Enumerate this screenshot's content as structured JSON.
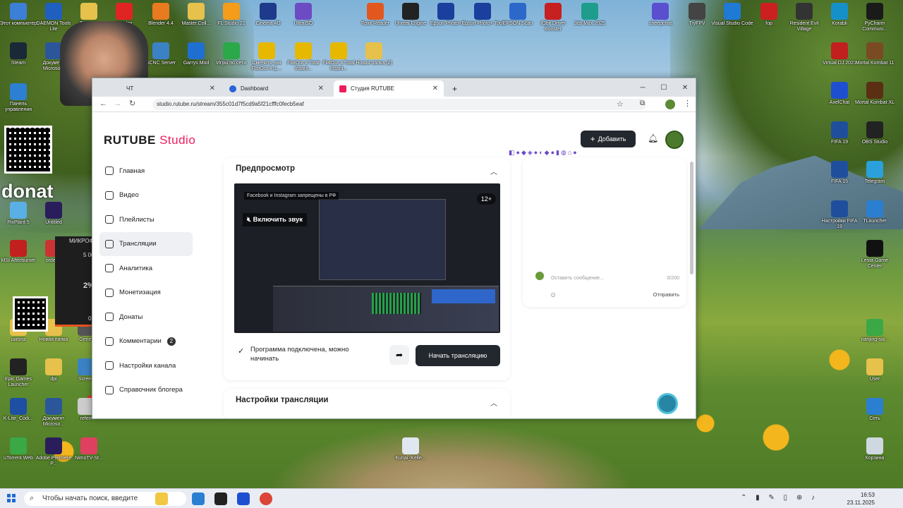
{
  "desktop": {
    "icons_left": [
      {
        "label": "Этот компьютер",
        "color": "#3c7fd6"
      },
      {
        "label": "DAEMON Tools Lite",
        "color": "#1f5fbf"
      },
      {
        "label": "Лазарев",
        "color": "#e6c14c"
      },
      {
        "label": "Yandex",
        "color": "#e02424"
      },
      {
        "label": "Blender 4.4",
        "color": "#e87a20"
      },
      {
        "label": "Master.Coll...",
        "color": "#e6c14c"
      },
      {
        "label": "FL Studio 21",
        "color": "#f59c1a"
      },
      {
        "label": "Cinema 4D",
        "color": "#1e3a8a"
      },
      {
        "label": "UltraISO",
        "color": "#6d4bc3"
      }
    ],
    "icons_right": [
      {
        "label": "Foxit Reader",
        "color": "#e2571e"
      },
      {
        "label": "Unreal Engine",
        "color": "#222222"
      },
      {
        "label": "Epson Photo+",
        "color": "#1a3f9c"
      },
      {
        "label": "Epson Photo+ Tool",
        "color": "#1a3f9c"
      },
      {
        "label": "EPSON Scan",
        "color": "#2b68c9"
      },
      {
        "label": "IObit Driver Booster",
        "color": "#c62020"
      },
      {
        "label": "3ds Max 2025",
        "color": "#1e9c8c"
      },
      {
        "label": "sheepchat",
        "color": "#5a4fcf"
      },
      {
        "label": "TryFPV",
        "color": "#444444"
      },
      {
        "label": "Visual Studio Code",
        "color": "#1f7ad6"
      },
      {
        "label": "fop",
        "color": "#cc1f1f"
      },
      {
        "label": "Resident Evil Village",
        "color": "#333333"
      },
      {
        "label": "Korabli",
        "color": "#1690c9"
      },
      {
        "label": "PyCharm Communi...",
        "color": "#1a1a1a"
      }
    ],
    "icons_row2": [
      {
        "label": "Steam",
        "color": "#1b2838"
      },
      {
        "label": "Документ Microso...",
        "color": "#2b579a"
      },
      {
        "label": "SCNC Server",
        "color": "#3b82c4"
      },
      {
        "label": "Garrys Mod",
        "color": "#1f6fd1"
      },
      {
        "label": "Игры по сети",
        "color": "#2aa84a"
      },
      {
        "label": "Сменить ник FlatOut 4 (L...",
        "color": "#e6b800"
      },
      {
        "label": "FlatOut 4 Total Insani...",
        "color": "#e6b800"
      },
      {
        "label": "FlatOut 4 Total Insani...",
        "color": "#e6b800"
      },
      {
        "label": "Новая папка (2)",
        "color": "#e6c14c"
      }
    ],
    "icons_far_left": [
      {
        "label": "Панель управления",
        "color": "#2d7fd1"
      },
      {
        "label": "PixPlant 5",
        "color": "#5ab0e6"
      },
      {
        "label": "MSI Afterburner",
        "color": "#c21f1f"
      },
      {
        "label": "школа",
        "color": "#e6c14c"
      },
      {
        "label": "Epic Games Launcher",
        "color": "#222222"
      },
      {
        "label": "K-Lite_Codi...",
        "color": "#1e4fa3"
      },
      {
        "label": "uTorrent Web",
        "color": "#3aa845"
      }
    ],
    "icons_far_right": [
      {
        "label": "Virtual DJ 2021",
        "color": "#c21f1f"
      },
      {
        "label": "Mortal Kombat 11",
        "color": "#7a4b22"
      },
      {
        "label": "AxelChat",
        "color": "#1f4fd1"
      },
      {
        "label": "Mortal Kombat XL",
        "color": "#5a2f14"
      },
      {
        "label": "FIFA 19",
        "color": "#1f4f9c"
      },
      {
        "label": "OBS Studio",
        "color": "#222222"
      },
      {
        "label": "FIFA 15",
        "color": "#1f4f9c"
      },
      {
        "label": "Telegram",
        "color": "#2aa1da"
      },
      {
        "label": "Настройки FIFA 19",
        "color": "#1f4f9c"
      },
      {
        "label": "TLauncher",
        "color": "#2a7fd1"
      },
      {
        "label": "Lesta Game Center",
        "color": "#111111"
      },
      {
        "label": "nanjing-sw...",
        "color": "#3aa845"
      },
      {
        "label": "User",
        "color": "#e6c14c"
      },
      {
        "label": "Сеть",
        "color": "#2a7fd1"
      },
      {
        "label": "Корзина",
        "color": "#cfd8e0"
      }
    ],
    "icons_bottom": [
      {
        "label": "Adobe Premiere P...",
        "color": "#2a1d5c"
      },
      {
        "label": "NimoTV-St...",
        "color": "#e04060"
      },
      {
        "label": "Kunai_Kelle...",
        "color": "#dfe8f0"
      },
      {
        "label": "Документ Microso...",
        "color": "#2b579a"
      },
      {
        "label": "dpi",
        "color": "#e6c14c"
      },
      {
        "label": "Новая папка",
        "color": "#e6c14c"
      },
      {
        "label": "Untitled",
        "color": "#2a1d5c"
      },
      {
        "label": "Gener",
        "color": "#555555"
      },
      {
        "label": "Screen",
        "color": "#3b82c4"
      },
      {
        "label": "order-3",
        "color": "#cc3333"
      },
      {
        "label": "referr",
        "color": "#cccccc"
      }
    ]
  },
  "overlay": {
    "donat_text": "donat",
    "mic_label": "МИКРОФОН",
    "mic_max": "5 000",
    "mic_pct": "2%",
    "mic_min": "0"
  },
  "browser": {
    "tabs": [
      {
        "label": "ЧТ",
        "active": false
      },
      {
        "label": "Dashboard",
        "active": false
      },
      {
        "label": "Студия RUTUBE",
        "active": true
      }
    ],
    "url": "studio.rutube.ru/stream/355c01d7f5cd9a5f21cfffc0fecb5eaf",
    "new_tab": "+",
    "minimize": "─",
    "maximize": "☐",
    "close": "✕"
  },
  "studio": {
    "logo_main": "RUTUBE",
    "logo_sub": "Studio",
    "add_button": "Добавить",
    "nav": [
      {
        "label": "Главная"
      },
      {
        "label": "Видео"
      },
      {
        "label": "Плейлисты"
      },
      {
        "label": "Трансляции",
        "active": true
      },
      {
        "label": "Аналитика"
      },
      {
        "label": "Монетизация"
      },
      {
        "label": "Донаты"
      },
      {
        "label": "Комментарии",
        "badge": "2"
      },
      {
        "label": "Настройки канала"
      },
      {
        "label": "Справочник блогера"
      }
    ],
    "preview_title": "Предпросмотр",
    "video": {
      "age": "12+",
      "unmute": "Включить звук",
      "warning": "Facebook и Instagram запрещены в РФ"
    },
    "status_text": "Программа подключена, можно начинать",
    "start_button": "Начать трансляцию",
    "settings_title": "Настройки трансляции",
    "chat": {
      "placeholder": "Оставить сообщение...",
      "counter": "0/200",
      "send": "Отправить"
    }
  },
  "taskbar": {
    "search_placeholder": "Чтобы начать поиск, введите",
    "time": "16:53",
    "date": "23.11.2025"
  }
}
